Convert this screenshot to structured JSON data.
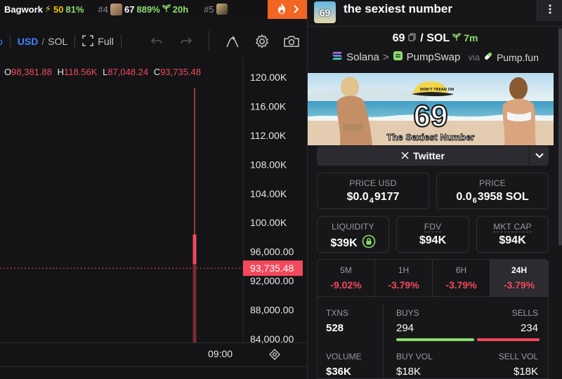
{
  "ticker": {
    "items": [
      {
        "name": "Bagwork",
        "score": "50",
        "pct": "81%"
      },
      {
        "rank": "#4",
        "name": "67",
        "pct": "889%",
        "age": "20h"
      },
      {
        "rank": "#5"
      }
    ],
    "fire_icon": "fire-icon"
  },
  "toolbar": {
    "currency_usd": "USD",
    "currency_sep": "/",
    "currency_sol": "SOL",
    "full_label": "Full",
    "icons": [
      "undo-icon",
      "redo-icon",
      "indicator-icon",
      "gear-icon",
      "camera-icon"
    ]
  },
  "ohlc": {
    "o_label": "O",
    "o": "98,381.88",
    "h_label": "H",
    "h": "118.56K",
    "l_label": "L",
    "l": "87,048.24",
    "c_label": "C",
    "c": "93,735.48"
  },
  "chart_data": {
    "type": "candlestick",
    "y_ticks": [
      "120.00K",
      "116.00K",
      "112.00K",
      "108.00K",
      "104.00K",
      "100.00K",
      "96,000.00",
      "92,000.00",
      "88,000.00",
      "84,000.00"
    ],
    "y_tick_values": [
      120000,
      116000,
      112000,
      108000,
      104000,
      100000,
      96000,
      92000,
      88000,
      84000
    ],
    "ylim": [
      84000,
      120000
    ],
    "x_ticks": [
      "09:00"
    ],
    "candles": [
      {
        "open": 98381.88,
        "high": 118560,
        "low": 87048.24,
        "close": 93735.48
      }
    ],
    "last_price": 93735.48,
    "last_price_label": "93,735.48",
    "volume": [
      {
        "level": 0.3
      }
    ],
    "colors": {
      "down": "#f2495c",
      "up": "#8ddc6b",
      "grid": "#2a2a2f",
      "price_line": "#f2495c"
    }
  },
  "panel": {
    "logo_text": "69",
    "title": "the sexiest number",
    "pair": {
      "base": "69",
      "sep": "/",
      "quote": "SOL",
      "age": "7m"
    },
    "route": {
      "chain": "Solana",
      "arrow": ">",
      "dex": "PumpSwap",
      "via": "via",
      "launchpad": "Pump.fun"
    },
    "banner": {
      "big": "69",
      "caption": "The Sexiest Number",
      "hat_text": "DON'T TREAD ON"
    },
    "twitter_label": "Twitter",
    "price_usd": {
      "label": "PRICE USD",
      "prefix": "$0.0",
      "sub": "4",
      "rest": "9177"
    },
    "price_sol": {
      "label": "PRICE",
      "prefix": "0.0",
      "sub": "6",
      "rest": "3958 SOL"
    },
    "liquidity": {
      "label": "LIQUIDITY",
      "value": "$39K"
    },
    "fdv": {
      "label": "FDV",
      "value": "$94K"
    },
    "mkt_cap": {
      "label": "MKT CAP",
      "value": "$94K"
    },
    "timeframes": [
      {
        "label": "5M",
        "value": "-9.02%"
      },
      {
        "label": "1H",
        "value": "-3.79%"
      },
      {
        "label": "6H",
        "value": "-3.79%"
      },
      {
        "label": "24H",
        "value": "-3.79%"
      }
    ],
    "stats": {
      "txns_label": "TXNS",
      "txns": "528",
      "buys_label": "BUYS",
      "buys": "294",
      "sells_label": "SELLS",
      "sells": "234",
      "volume_label": "VOLUME",
      "volume": "$36K",
      "buy_vol_label": "BUY VOL",
      "buy_vol": "$18K",
      "sell_vol_label": "SELL VOL",
      "sell_vol": "$18K",
      "buy_share": 0.557
    },
    "colors": {
      "green": "#8ddc6b",
      "red": "#f2495c",
      "orange": "#f26522"
    }
  }
}
